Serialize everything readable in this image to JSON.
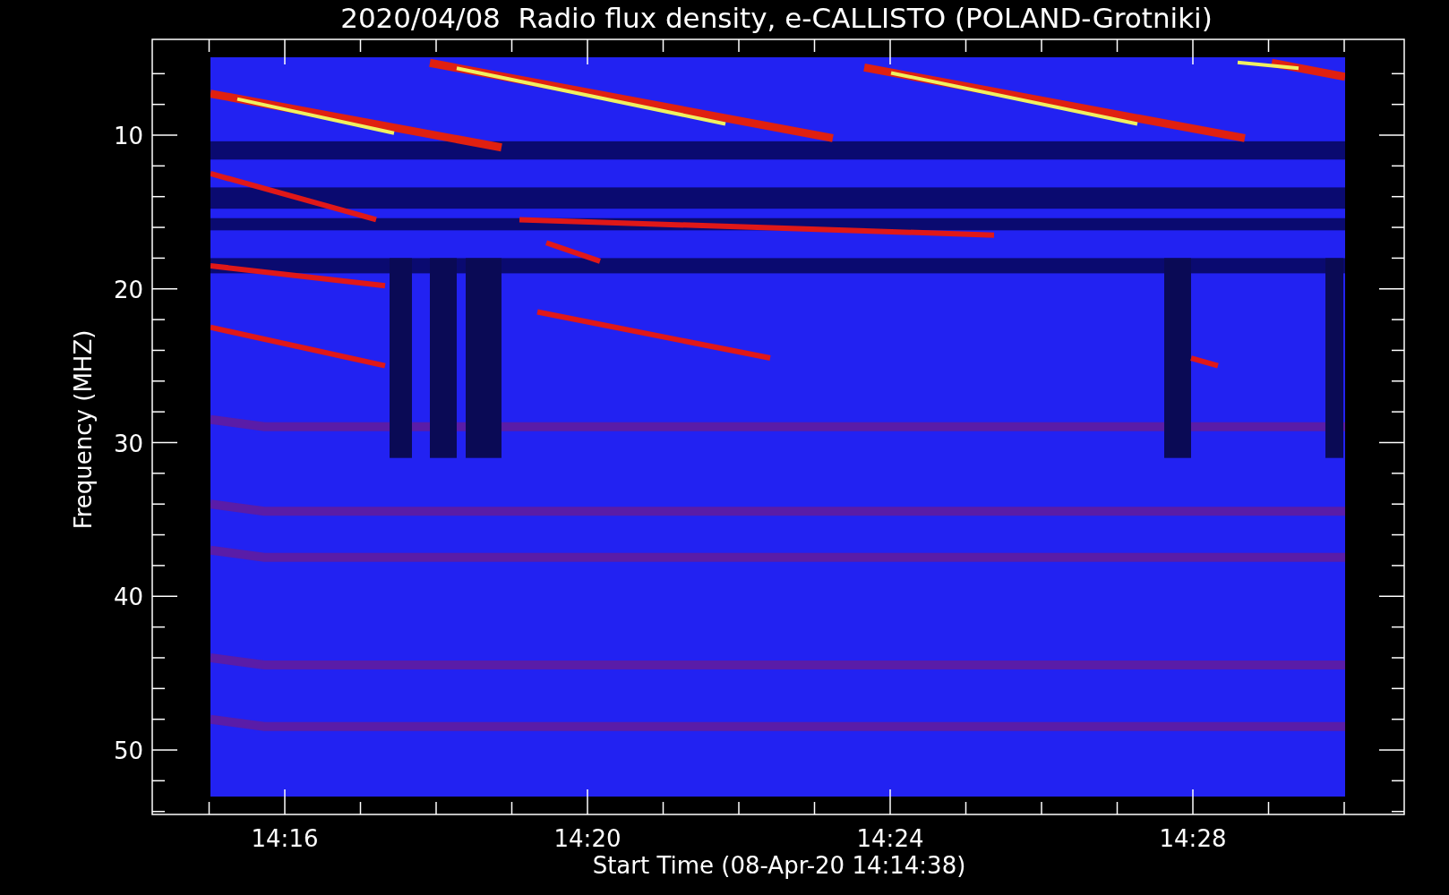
{
  "title": "2020/04/08  Radio flux density, e-CALLISTO (POLAND-Grotniki)",
  "plot": {
    "xlabel": "Start Time (08-Apr-20 14:14:38)",
    "ylabel": "Frequency (MHZ)",
    "xticks": [
      "14:16",
      "14:20",
      "14:24",
      "14:28"
    ],
    "yticks": [
      "10",
      "20",
      "30",
      "40",
      "50"
    ]
  }
}
